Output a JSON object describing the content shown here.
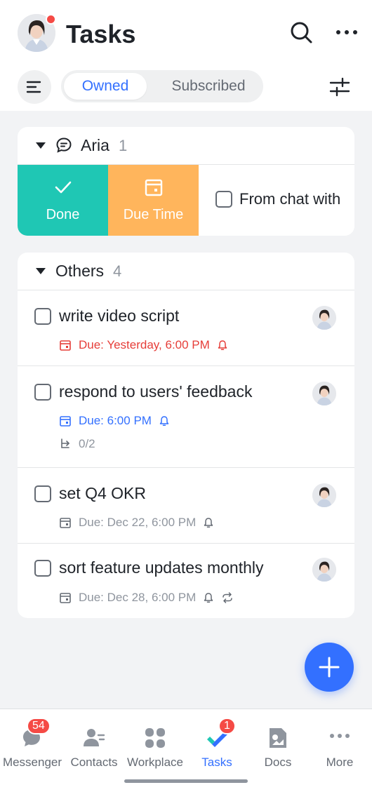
{
  "header": {
    "title": "Tasks",
    "has_notification_dot": true,
    "icons": [
      "search-icon",
      "more-icon"
    ]
  },
  "toolbar": {
    "menu_icon": "menu-icon",
    "segments": [
      {
        "label": "Owned",
        "active": true
      },
      {
        "label": "Subscribed",
        "active": false
      }
    ],
    "filter_icon": "filter-icon"
  },
  "groups": [
    {
      "name": "Aria",
      "count": "1",
      "icon": "chat-icon",
      "swipe_actions": [
        {
          "label": "Done",
          "color": "#1fc7b4",
          "icon": "check-icon"
        },
        {
          "label": "Due Time",
          "color": "#ffb55c",
          "icon": "calendar-icon"
        }
      ],
      "peek_task_title": "From chat with"
    },
    {
      "name": "Others",
      "count": "4",
      "tasks": [
        {
          "title": "write video script",
          "due": "Due: Yesterday, 6:00 PM",
          "due_color": "#e63e39",
          "reminder": true
        },
        {
          "title": "respond to users' feedback",
          "due": "Due: 6:00 PM",
          "due_color": "#3370ff",
          "reminder": true,
          "subtasks": "0/2"
        },
        {
          "title": "set Q4 OKR",
          "due": "Due: Dec 22, 6:00 PM",
          "due_color": "#8f959e",
          "reminder": true
        },
        {
          "title": "sort feature updates monthly",
          "due": "Due: Dec 28, 6:00 PM",
          "due_color": "#8f959e",
          "reminder": true,
          "repeat": true
        }
      ]
    }
  ],
  "fab": {
    "icon": "plus-icon"
  },
  "tabbar": [
    {
      "label": "Messenger",
      "badge": "54",
      "icon": "messenger-icon"
    },
    {
      "label": "Contacts",
      "icon": "contacts-icon"
    },
    {
      "label": "Workplace",
      "icon": "workplace-icon"
    },
    {
      "label": "Tasks",
      "badge": "1",
      "active": true,
      "icon": "tasks-icon"
    },
    {
      "label": "Docs",
      "icon": "docs-icon"
    },
    {
      "label": "More",
      "icon": "more-dots-icon"
    }
  ],
  "colors": {
    "accent": "#3370ff",
    "danger": "#f54a45"
  }
}
